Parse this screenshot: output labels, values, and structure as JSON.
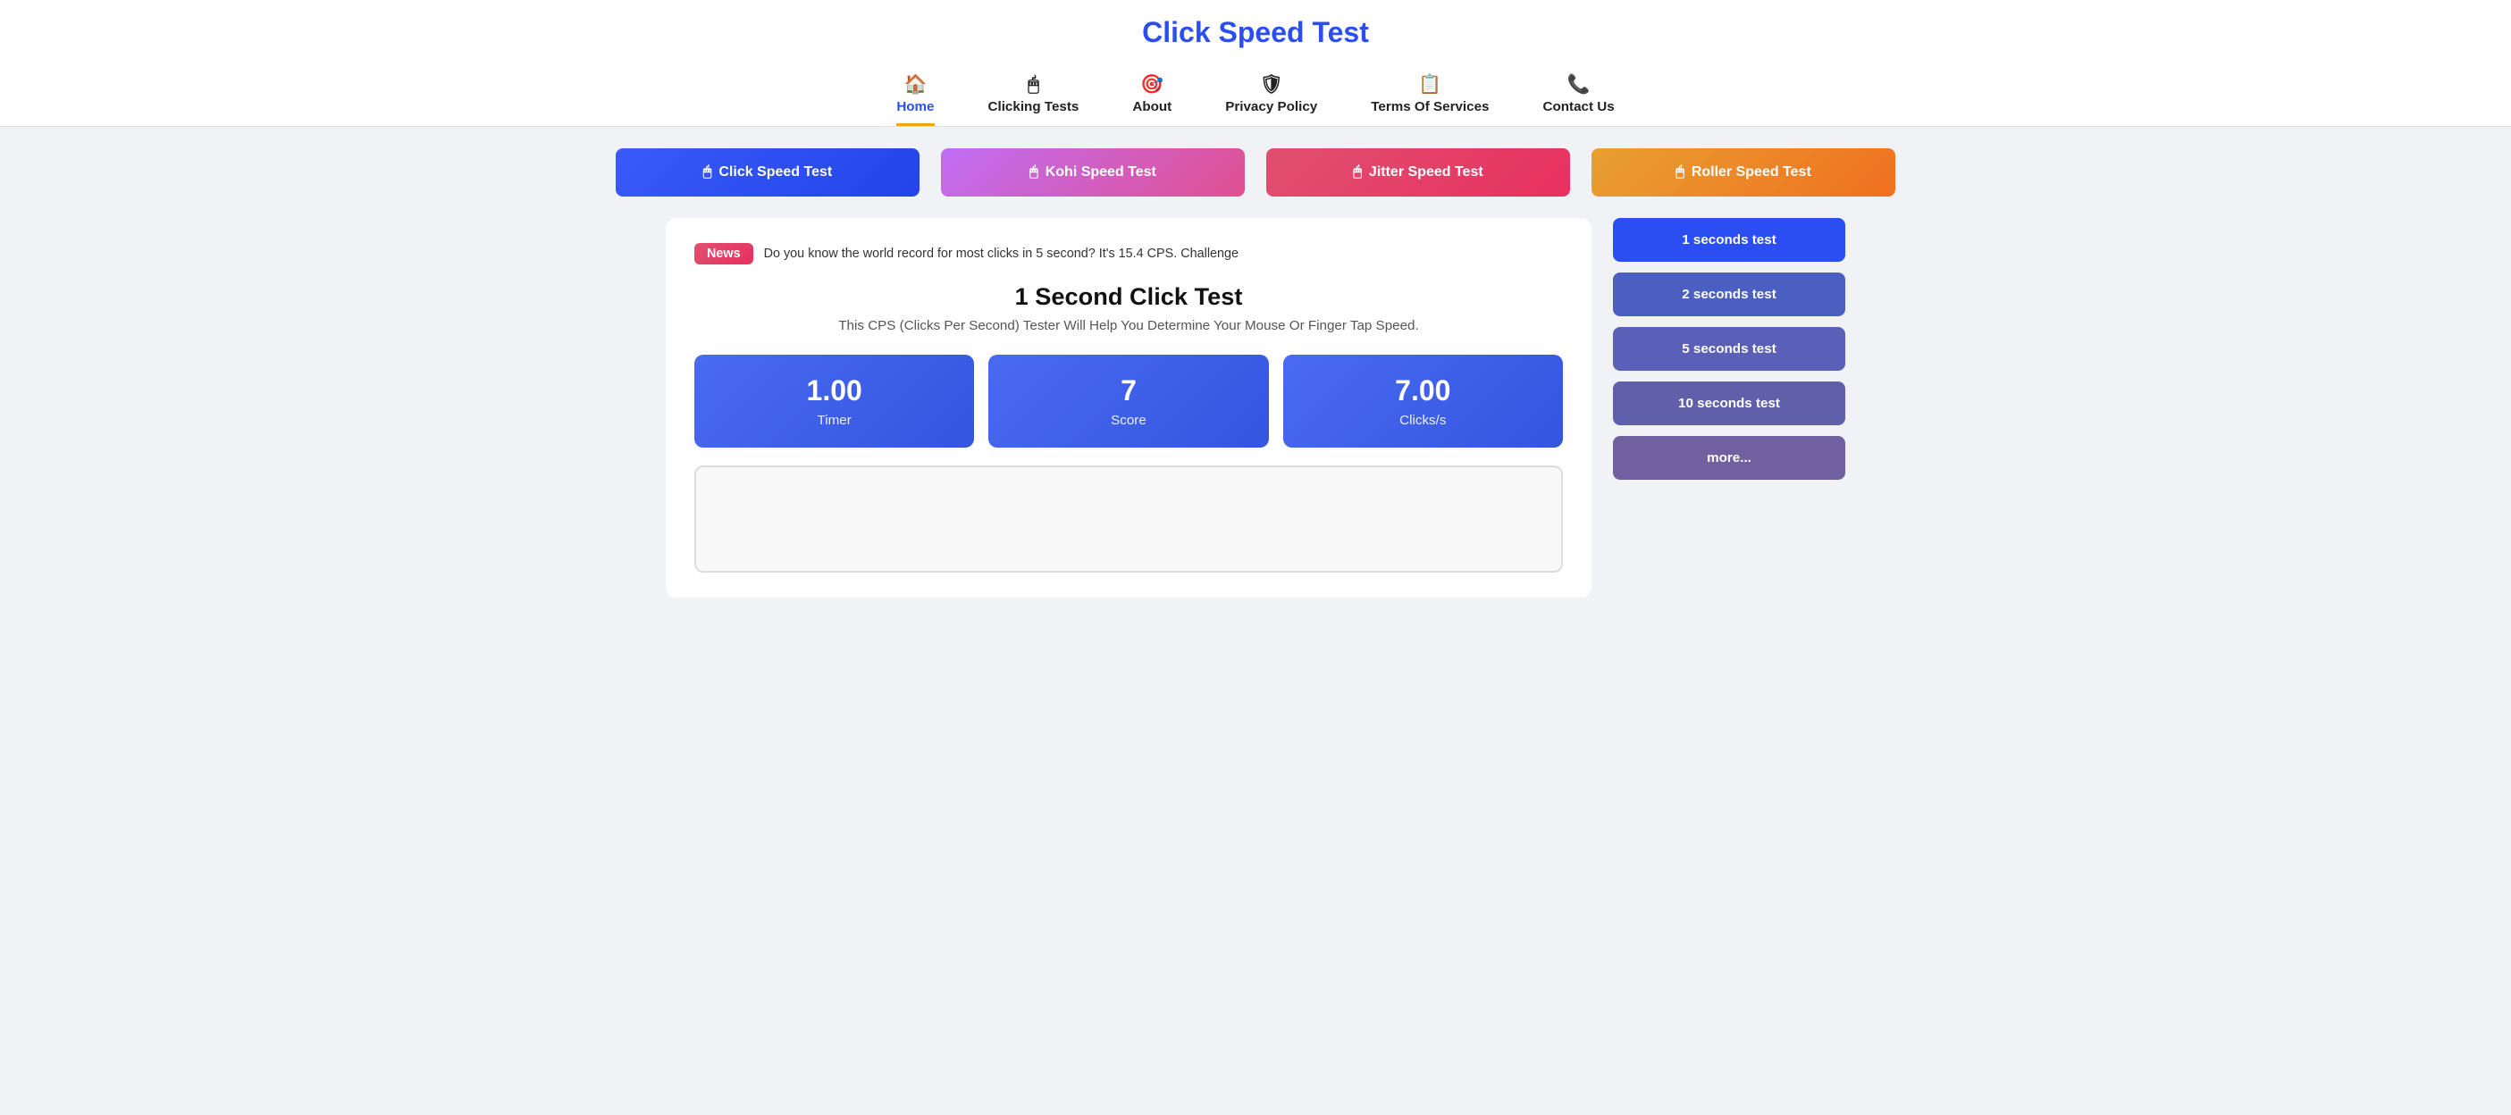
{
  "header": {
    "title": "Click Speed Test",
    "nav": [
      {
        "id": "home",
        "label": "Home",
        "icon": "🏠",
        "active": true
      },
      {
        "id": "clicking-tests",
        "label": "Clicking Tests",
        "icon": "🖱",
        "active": false
      },
      {
        "id": "about",
        "label": "About",
        "icon": "🎯",
        "active": false
      },
      {
        "id": "privacy-policy",
        "label": "Privacy Policy",
        "icon": "🛡",
        "active": false
      },
      {
        "id": "terms-of-services",
        "label": "Terms Of Services",
        "icon": "📋",
        "active": false
      },
      {
        "id": "contact-us",
        "label": "Contact Us",
        "icon": "📞",
        "active": false
      }
    ]
  },
  "top_buttons": [
    {
      "id": "click-speed-test",
      "label": "Click Speed Test",
      "class": "btn-blue"
    },
    {
      "id": "kohi-speed-test",
      "label": "Kohi Speed Test",
      "class": "btn-pink"
    },
    {
      "id": "jitter-speed-test",
      "label": "Jitter Speed Test",
      "class": "btn-red"
    },
    {
      "id": "roller-speed-test",
      "label": "Roller Speed Test",
      "class": "btn-orange"
    }
  ],
  "news": {
    "badge": "News",
    "text": "Do you know the world record for most clicks in 5 second? It's 15.4 CPS. Challenge"
  },
  "section": {
    "title": "1 Second Click Test",
    "subtitle": "This CPS (Clicks Per Second) Tester Will Help You Determine Your Mouse Or Finger Tap Speed."
  },
  "stats": [
    {
      "id": "timer",
      "value": "1.00",
      "label": "Timer"
    },
    {
      "id": "score",
      "value": "7",
      "label": "Score"
    },
    {
      "id": "clicks-per-second",
      "value": "7.00",
      "label": "Clicks/s"
    }
  ],
  "sidebar_buttons": [
    {
      "id": "1s",
      "label": "1 seconds test",
      "class": "sb-active"
    },
    {
      "id": "2s",
      "label": "2 seconds test",
      "class": "sb-2"
    },
    {
      "id": "5s",
      "label": "5 seconds test",
      "class": "sb-5"
    },
    {
      "id": "10s",
      "label": "10 seconds test",
      "class": "sb-10"
    },
    {
      "id": "more",
      "label": "more...",
      "class": "sb-more"
    }
  ]
}
